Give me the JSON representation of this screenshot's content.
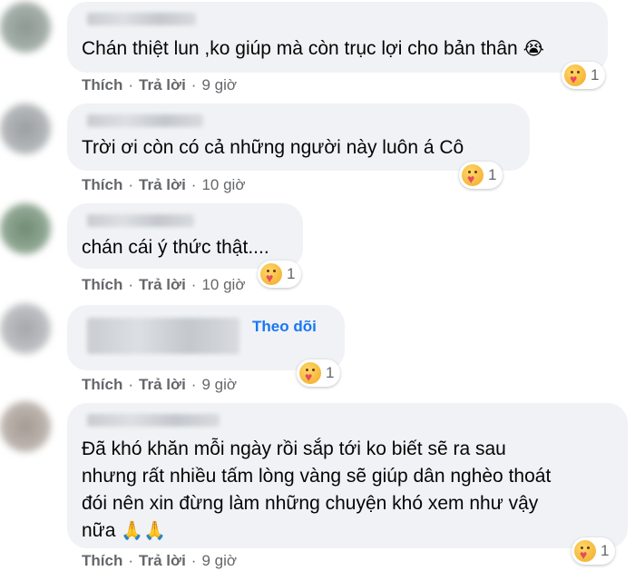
{
  "comments": [
    {
      "text_lines": [
        "Chán thiệt lun ,ko giúp mà còn trục lợi cho bản thân"
      ],
      "trailing_emoji": "😭",
      "reaction": {
        "icon": "care-icon",
        "count": "1"
      },
      "like_label": "Thích",
      "reply_label": "Trả lời",
      "time": "9 giờ"
    },
    {
      "text_lines": [
        "Trời ơi còn có cả những người này luôn á Cô"
      ],
      "reaction": {
        "icon": "care-icon",
        "count": "1"
      },
      "like_label": "Thích",
      "reply_label": "Trả lời",
      "time": "10 giờ"
    },
    {
      "text_lines": [
        "chán cái ý thức thật...."
      ],
      "reaction": {
        "icon": "care-icon",
        "count": "1"
      },
      "like_label": "Thích",
      "reply_label": "Trả lời",
      "time": "10 giờ"
    },
    {
      "text_lines": [],
      "follow_label": "Theo dõi",
      "reaction": {
        "icon": "care-icon",
        "count": "1"
      },
      "like_label": "Thích",
      "reply_label": "Trả lời",
      "time": "9 giờ"
    },
    {
      "text_lines": [
        "Đã khó khăn mỗi ngày rồi sắp tới ko biết sẽ ra sau",
        "nhưng rất nhiều tấm lòng vàng sẽ giúp dân nghèo thoát",
        "đói nên xin đừng làm những chuyện khó xem như vậy",
        "nữa"
      ],
      "trailing_emoji": "🙏🙏",
      "reaction": {
        "icon": "care-icon",
        "count": "1"
      },
      "like_label": "Thích",
      "reply_label": "Trả lời",
      "time": "9 giờ"
    }
  ],
  "separator": "·"
}
